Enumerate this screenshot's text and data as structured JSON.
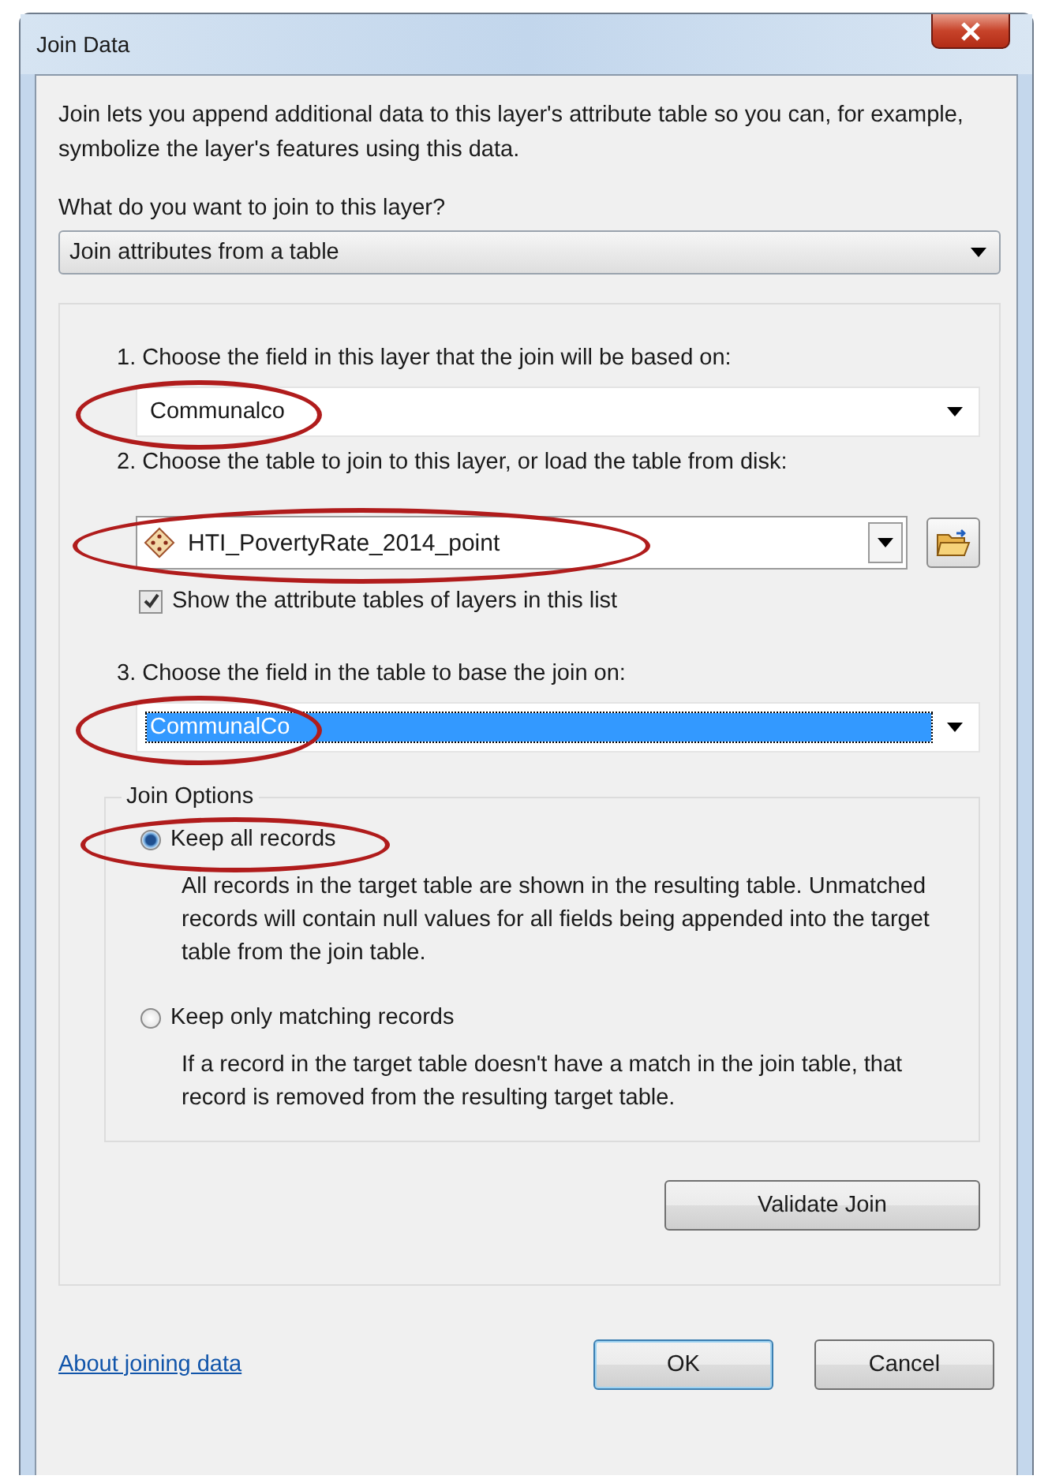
{
  "window": {
    "title": "Join Data"
  },
  "description": "Join lets you append additional data to this layer's attribute table so you can, for example, symbolize the layer's features using this data.",
  "join_type": {
    "label": "What do you want to join to this layer?",
    "value": "Join attributes from a table"
  },
  "steps": [
    {
      "kind": "field",
      "label": "1.  Choose the field in this layer that the join will be based on:",
      "value": "Communalco",
      "selected": false,
      "circled": true
    },
    {
      "kind": "table",
      "label": "2.  Choose the table to join to this layer, or load the table from disk:",
      "value": "HTI_PovertyRate_2014_point",
      "circled": true,
      "checkbox": {
        "label": "Show the attribute tables of layers in this list",
        "checked": true
      }
    },
    {
      "kind": "field",
      "label": "3.  Choose the field in the table to base the join on:",
      "value": "CommunalCo",
      "selected": true,
      "circled": true
    }
  ],
  "join_options": {
    "title": "Join Options",
    "options": [
      {
        "label": "Keep all records",
        "description": "All records in the target table are shown in the resulting table. Unmatched records will contain null values for all fields being appended into the target table from the join table.",
        "selected": true,
        "circled": true
      },
      {
        "label": "Keep only matching records",
        "description": "If a record in the target table doesn't have a match in the join table, that record is removed from the resulting target table.",
        "selected": false,
        "circled": false
      }
    ]
  },
  "validate_button": "Validate Join",
  "help_link": "About joining data",
  "buttons": [
    {
      "label": "OK",
      "default": true
    },
    {
      "label": "Cancel",
      "default": false
    }
  ]
}
